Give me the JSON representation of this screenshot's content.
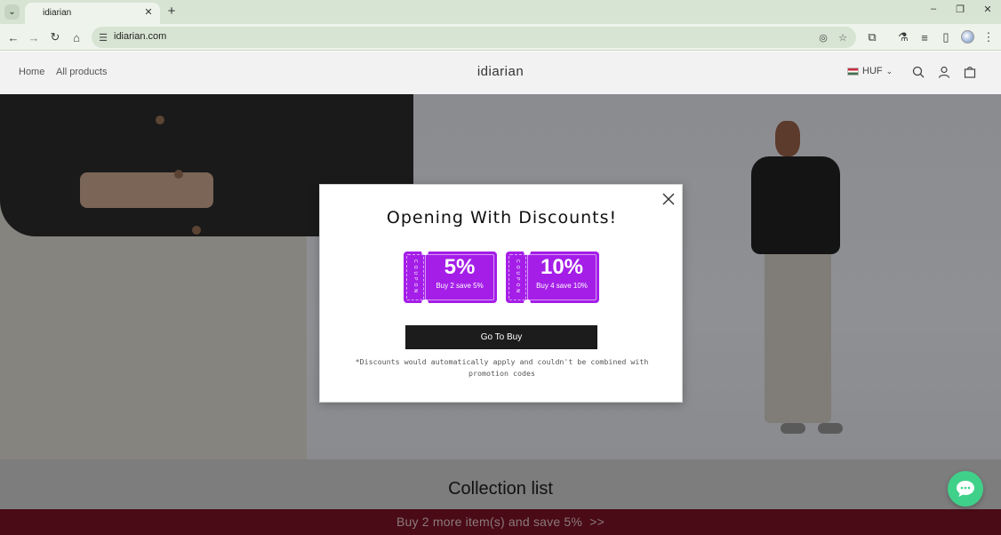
{
  "browser": {
    "tab_title": "idiarian",
    "url": "idiarian.com"
  },
  "header": {
    "nav": [
      "Home",
      "All products"
    ],
    "brand": "idiarian",
    "currency": "HUF"
  },
  "collection": {
    "title": "Collection list"
  },
  "promo_bar": {
    "text": "Buy 2 more item(s) and save 5%  >>"
  },
  "popup": {
    "title": "Opening With Discounts!",
    "coupons": [
      {
        "side_label": "COUPON",
        "value": "5%",
        "desc": "Buy 2 save 5%"
      },
      {
        "side_label": "COUPON",
        "value": "10%",
        "desc": "Buy 4 save 10%"
      }
    ],
    "cta": "Go To Buy",
    "note": "*Discounts would automatically apply and couldn't be combined with promotion codes"
  },
  "colors": {
    "coupon": "#a51ee8",
    "cta": "#1c1c1c",
    "chat": "#3fd18a",
    "promo_bar": "#4a0a16"
  }
}
